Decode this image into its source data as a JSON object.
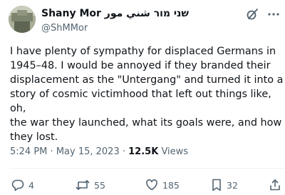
{
  "user": {
    "display_name": "Shany Mor שני מור شني مور",
    "handle": "@ShMMor"
  },
  "header_icons": [
    "grok-icon",
    "more-icon"
  ],
  "tweet": {
    "text": "I have plenty of sympathy for displaced Germans in\n1945–48. I would be annoyed if they branded their\ndisplacement as the \"Untergang\" and turned it into a\nstory of cosmic victimhood that left out things like, oh,\nthe war they launched, what its goals were, and how\nthey lost.",
    "time": "5:24 PM",
    "separator": "·",
    "date": "May 15, 2023",
    "views_count": "12.5K",
    "views_label": "Views"
  },
  "actions": {
    "replies": "4",
    "reposts": "55",
    "likes": "185",
    "bookmarks": "32"
  },
  "colors": {
    "text": "#0f1419",
    "secondary": "#536471",
    "divider": "#eff3f4"
  }
}
